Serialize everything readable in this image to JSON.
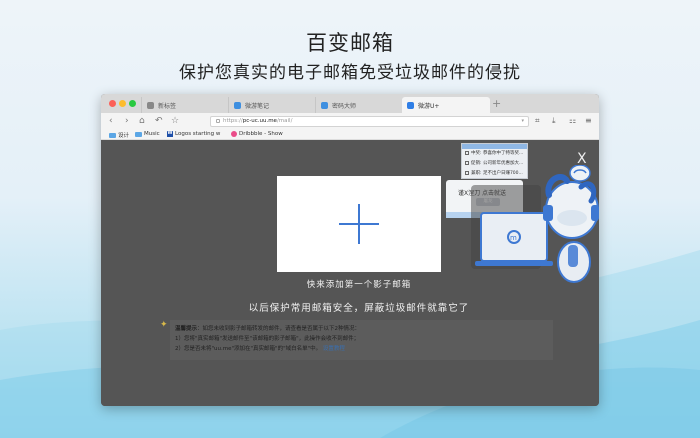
{
  "headline": "百变邮箱",
  "subheadline": "保护您真实的电子邮箱免受垃圾邮件的侵扰",
  "colors": {
    "accent": "#3e78d2",
    "overlay": "#555555",
    "window_chrome": "#d8d8d8"
  },
  "browser": {
    "tabs": [
      {
        "label": "新标签",
        "icon": "grid-icon"
      },
      {
        "label": "微游笔记",
        "icon": "note-icon"
      },
      {
        "label": "密码大师",
        "icon": "lock-icon"
      },
      {
        "label": "微游U+",
        "icon": "uplus-icon",
        "active": true
      }
    ],
    "new_tab": "+",
    "nav": {
      "back": "‹",
      "forward": "›",
      "home": "⌂",
      "undo": "↶",
      "star": "☆"
    },
    "url": {
      "scheme": "https://",
      "host": "pc-uc.uu.me",
      "path": "/mail/",
      "dropdown": "▾"
    },
    "tools": {
      "download": "⤓",
      "extensions": "⚏",
      "menu": "≡",
      "reader": "⌗"
    },
    "bookmarks": [
      {
        "label": "设计",
        "icon": "folder-icon"
      },
      {
        "label": "Music",
        "icon": "folder-icon"
      },
      {
        "label": "Logos starting w",
        "icon": "w-icon",
        "badge": "W"
      },
      {
        "label": "Dribbble - Show",
        "icon": "dribbble-icon"
      }
    ]
  },
  "overlay": {
    "close": "X",
    "add_caption": "快来添加第一个影子邮箱",
    "protect_caption": "以后保护常用邮箱安全，屏蔽垃圾邮件就靠它了",
    "notice": {
      "title": "温馨提示",
      "intro": "：如您未收到影子邮箱转发的邮件，请查看是否属于以下2种情况：",
      "line1": "1）您将\"真实邮箱\"发送邮件至\"该邮箱的影子邮箱\"，此操作会收不到邮件；",
      "line2": "2）您是否未将\"uu.me\"添加在\"真实邮箱\"的\"域白名单\"中。",
      "link": "设置教程"
    },
    "illustration": {
      "mini_rows": [
        "中奖: 恭喜你中了特等奖...",
        "促销: 公司新年优惠加大...",
        "兼职: 足不出户日赚700..."
      ],
      "bubble_text": "谨X涅刀 点击就送",
      "bubble_button": "屠龙"
    }
  }
}
